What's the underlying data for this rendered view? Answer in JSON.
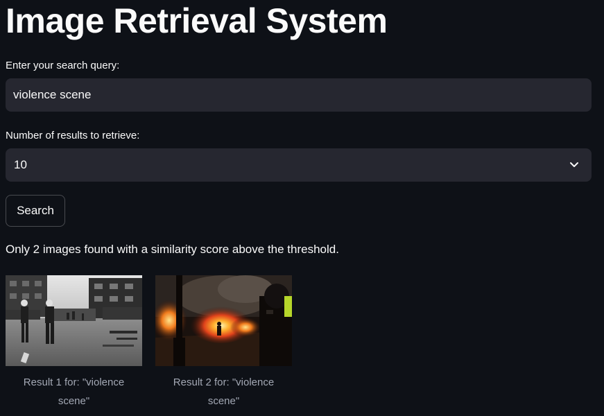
{
  "app": {
    "title": "Image Retrieval System"
  },
  "query": {
    "label": "Enter your search query:",
    "value": "violence scene"
  },
  "num_results": {
    "label": "Number of results to retrieve:",
    "selected": "10"
  },
  "search_button": {
    "label": "Search"
  },
  "status": {
    "message": "Only 2 images found with a similarity score above the threshold."
  },
  "results": [
    {
      "caption": "Result 1 for: \"violence scene\"",
      "image": "street-crowd-photo"
    },
    {
      "caption": "Result 2 for: \"violence scene\"",
      "image": "street-fire-photo"
    }
  ],
  "colors": {
    "background": "#0e1117",
    "input_background": "#262730",
    "text": "#fafafa",
    "caption_text": "#a3a8b4"
  }
}
